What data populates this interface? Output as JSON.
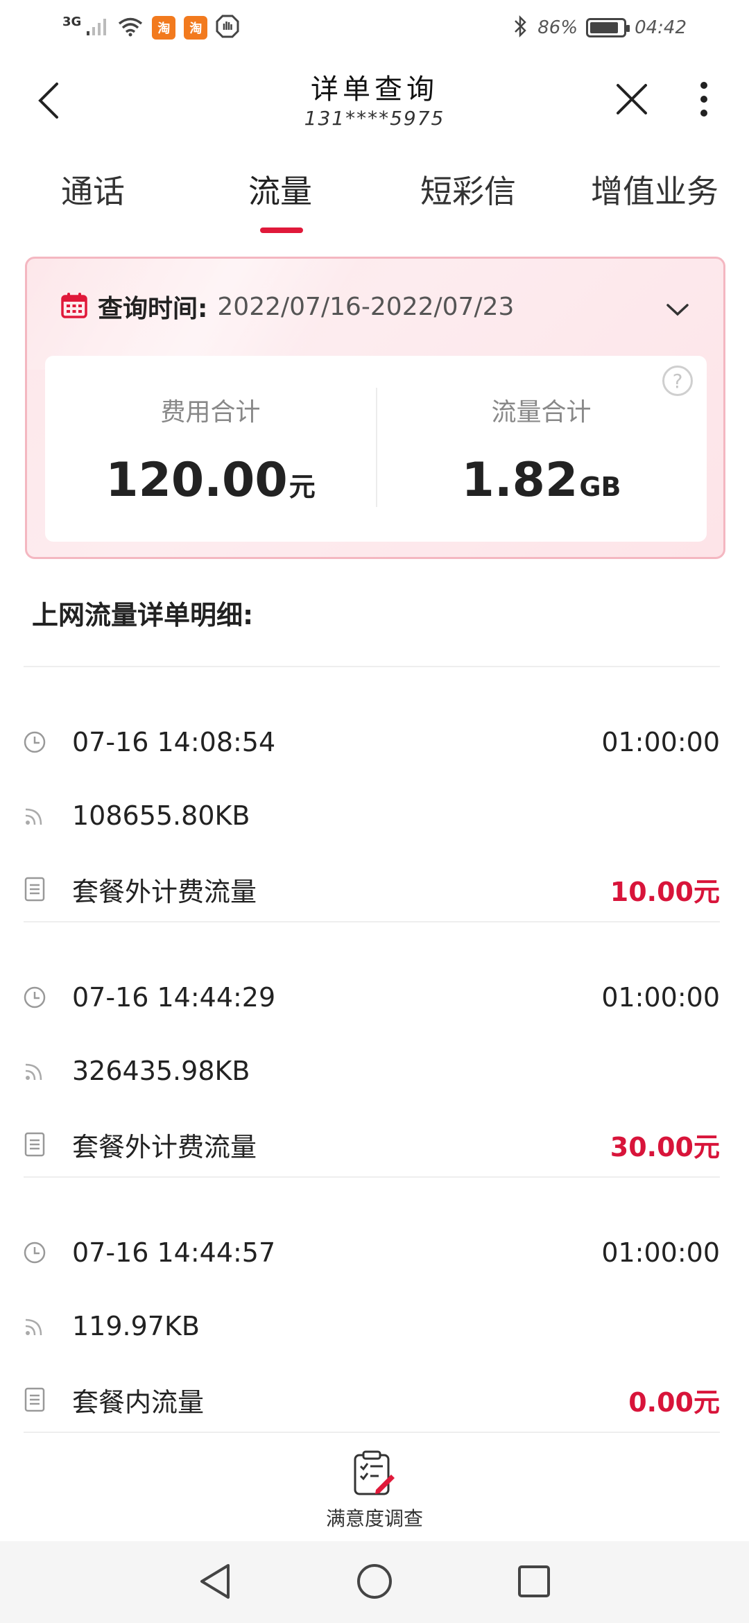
{
  "status_bar": {
    "network": "3G",
    "app_badges": [
      "淘",
      "淘"
    ],
    "battery_percent": "86%",
    "battery_level": 0.86,
    "time": "04:42"
  },
  "header": {
    "title": "详单查询",
    "subtitle": "131****5975"
  },
  "tabs": [
    {
      "label": "通话",
      "active": false
    },
    {
      "label": "流量",
      "active": true
    },
    {
      "label": "短彩信",
      "active": false
    },
    {
      "label": "增值业务",
      "active": false
    }
  ],
  "summary": {
    "query_label": "查询时间:",
    "query_range": "2022/07/16-2022/07/23",
    "fee_label": "费用合计",
    "fee_value": "120.00",
    "fee_unit": "元",
    "data_label": "流量合计",
    "data_value": "1.82",
    "data_unit": "GB",
    "help_glyph": "?"
  },
  "section_title": "上网流量详单明细:",
  "records": [
    {
      "time": "07-16 14:08:54",
      "duration": "01:00:00",
      "volume": "108655.80KB",
      "type": "套餐外计费流量",
      "fee": "10.00元"
    },
    {
      "time": "07-16 14:44:29",
      "duration": "01:00:00",
      "volume": "326435.98KB",
      "type": "套餐外计费流量",
      "fee": "30.00元"
    },
    {
      "time": "07-16 14:44:57",
      "duration": "01:00:00",
      "volume": "119.97KB",
      "type": "套餐内流量",
      "fee": "0.00元"
    }
  ],
  "survey": {
    "label": "满意度调查"
  },
  "colors": {
    "accent": "#e0193a",
    "fee": "#d8143a",
    "card_border": "#f4b7c1",
    "card_bg": "#fde7ea"
  }
}
